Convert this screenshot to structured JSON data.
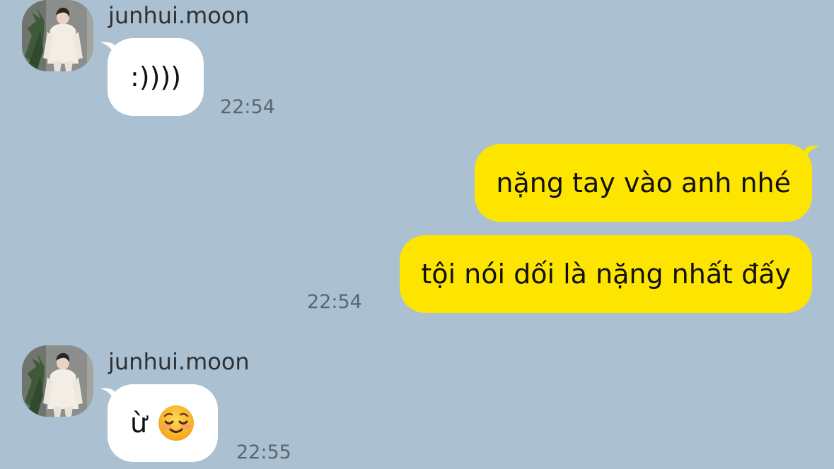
{
  "messages": [
    {
      "sender": "junhui.moon",
      "text": ":))))",
      "time": "22:54"
    },
    {
      "text": "nặng tay vào anh nhé"
    },
    {
      "text": "tội nói dối là nặng nhất đấy",
      "time": "22:54"
    },
    {
      "sender": "junhui.moon",
      "text": "ừ",
      "emoji": "smiling-face-emoji",
      "time": "22:55"
    }
  ],
  "colors": {
    "background": "#abc1d1",
    "incoming_bubble": "#ffffff",
    "outgoing_bubble": "#fee500",
    "timestamp": "#5b6670",
    "name": "#2f3133"
  },
  "icons": {
    "avatar": "profile-photo-avatar",
    "emoji": "smiling-face-emoji"
  }
}
